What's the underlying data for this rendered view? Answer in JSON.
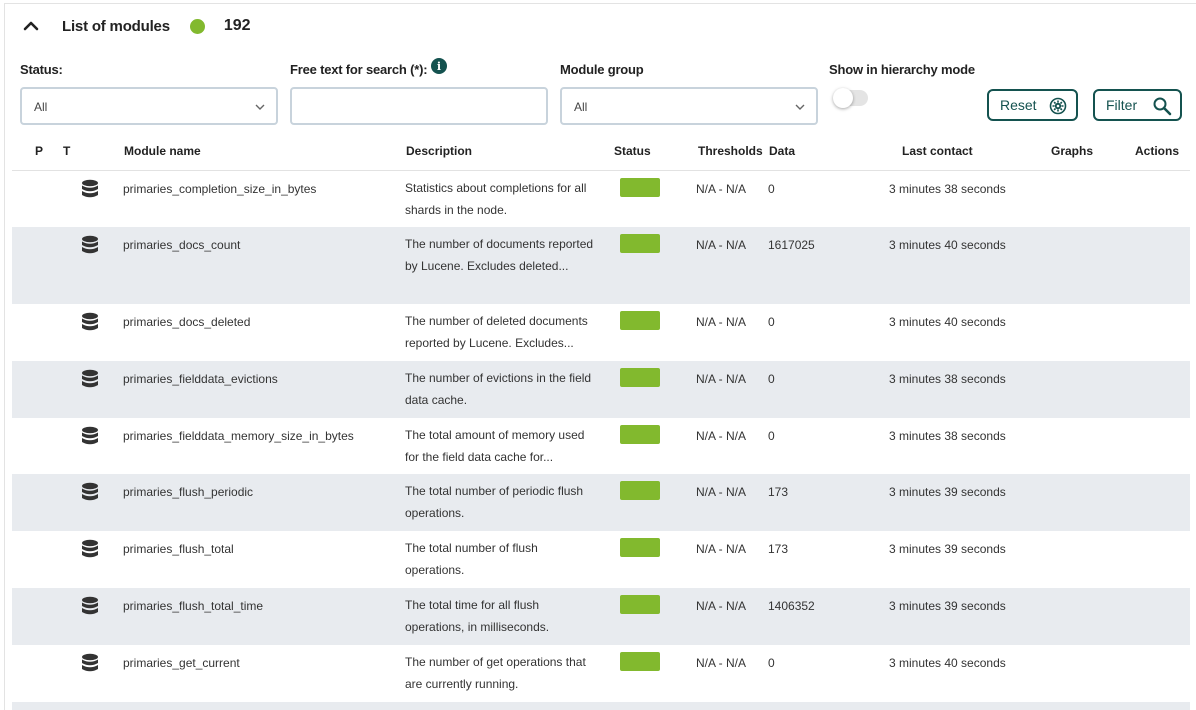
{
  "header": {
    "title": "List of modules",
    "count": "192",
    "status_color": "#82b92e"
  },
  "filters": {
    "status_label": "Status:",
    "status_value": "All",
    "search_label": "Free text for search (*):",
    "search_value": "",
    "group_label": "Module group",
    "group_value": "All",
    "hierarchy_label": "Show in hierarchy mode",
    "hierarchy_on": false,
    "reset_label": "Reset",
    "filter_label": "Filter"
  },
  "table": {
    "columns": {
      "p": "P",
      "t": "T",
      "name": "Module name",
      "description": "Description",
      "status": "Status",
      "thresholds": "Thresholds",
      "data": "Data",
      "last_contact": "Last contact",
      "graphs": "Graphs",
      "actions": "Actions"
    },
    "rows": [
      {
        "name": "primaries_completion_size_in_bytes",
        "description": "Statistics about completions for all shards in the node.",
        "status": "normal",
        "thresholds": "N/A - N/A",
        "data": "0",
        "last_contact": "3 minutes 38 seconds"
      },
      {
        "name": "primaries_docs_count",
        "description": "The number of documents reported by Lucene. Excludes deleted...",
        "status": "normal",
        "thresholds": "N/A - N/A",
        "data": "1617025",
        "last_contact": "3 minutes 40 seconds"
      },
      {
        "name": "primaries_docs_deleted",
        "description": "The number of deleted documents reported by Lucene. Excludes...",
        "status": "normal",
        "thresholds": "N/A - N/A",
        "data": "0",
        "last_contact": "3 minutes 40 seconds"
      },
      {
        "name": "primaries_fielddata_evictions",
        "description": "The number of evictions in the field data cache.",
        "status": "normal",
        "thresholds": "N/A - N/A",
        "data": "0",
        "last_contact": "3 minutes 38 seconds"
      },
      {
        "name": "primaries_fielddata_memory_size_in_bytes",
        "description": "The total amount of memory used for the field data cache for...",
        "status": "normal",
        "thresholds": "N/A - N/A",
        "data": "0",
        "last_contact": "3 minutes 38 seconds"
      },
      {
        "name": "primaries_flush_periodic",
        "description": "The total number of periodic flush operations.",
        "status": "normal",
        "thresholds": "N/A - N/A",
        "data": "173",
        "last_contact": "3 minutes 39 seconds"
      },
      {
        "name": "primaries_flush_total",
        "description": "The total number of flush operations.",
        "status": "normal",
        "thresholds": "N/A - N/A",
        "data": "173",
        "last_contact": "3 minutes 39 seconds"
      },
      {
        "name": "primaries_flush_total_time",
        "description": "The total time for all flush operations, in milliseconds.",
        "status": "normal",
        "thresholds": "N/A - N/A",
        "data": "1406352",
        "last_contact": "3 minutes 39 seconds"
      },
      {
        "name": "primaries_get_current",
        "description": "The number of get operations that are currently running.",
        "status": "normal",
        "thresholds": "N/A - N/A",
        "data": "0",
        "last_contact": "3 minutes 40 seconds"
      }
    ]
  },
  "colors": {
    "accent": "#14524f",
    "status_normal": "#82b92e",
    "row_alt": "#e8ebef"
  },
  "icons": {
    "module_type": "database-icon",
    "collapse": "chevron-up-icon",
    "info": "info-icon",
    "reset": "gear-refresh-icon",
    "filter": "magnifier-icon"
  }
}
